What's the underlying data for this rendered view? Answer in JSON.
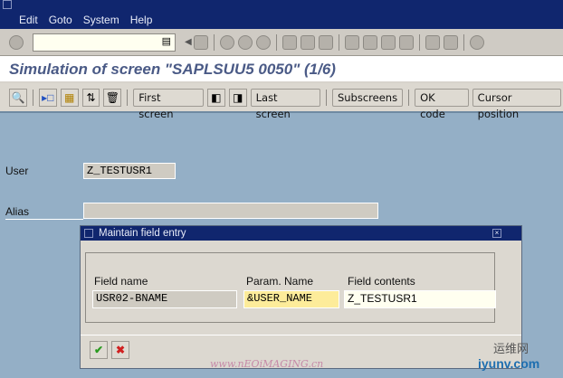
{
  "menu": [
    "Edit",
    "Goto",
    "System",
    "Help"
  ],
  "command_field": {
    "value": ""
  },
  "page_title": "Simulation of screen \"SAPLSUU5 0050\" (1/6)",
  "app_toolbar": {
    "first_screen": "First screen",
    "last_screen": "Last screen",
    "subscreens": "Subscreens",
    "ok_code": "OK code",
    "cursor_position": "Cursor position"
  },
  "form": {
    "user_label": "User",
    "user_value": "Z_TESTUSR1",
    "alias_label": "Alias",
    "alias_value": ""
  },
  "dialog": {
    "title": "Maintain field entry",
    "col_field_name": "Field name",
    "col_param_name": "Param. Name",
    "col_field_contents": "Field contents",
    "field_name": "USR02-BNAME",
    "param_name": "&USER_NAME",
    "field_contents": "Z_TESTUSR1"
  },
  "watermark": {
    "site1": "www.nEOiMAGING.cn",
    "site2_cn": "运维网",
    "site2": "iyunv.com"
  }
}
